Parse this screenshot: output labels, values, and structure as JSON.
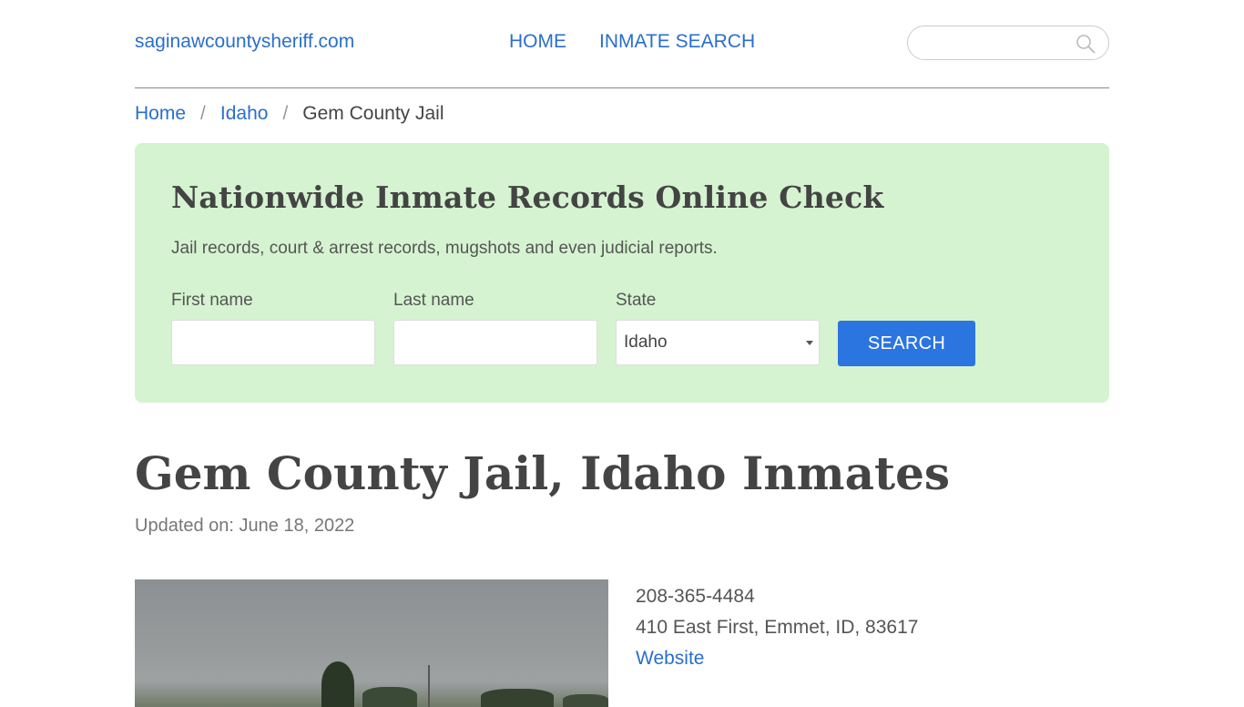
{
  "header": {
    "site_name": "saginawcountysheriff.com",
    "nav": [
      "HOME",
      "INMATE SEARCH"
    ],
    "search_placeholder": ""
  },
  "breadcrumb": {
    "items": [
      "Home",
      "Idaho"
    ],
    "current": "Gem County Jail",
    "separator": "/"
  },
  "panel": {
    "title": "Nationwide Inmate Records Online Check",
    "subtitle": "Jail records, court & arrest records, mugshots and even judicial reports.",
    "first_name_label": "First name",
    "first_name_value": "",
    "last_name_label": "Last name",
    "last_name_value": "",
    "state_label": "State",
    "state_value": "Idaho",
    "search_button": "SEARCH",
    "background_color": "#d5f3d0",
    "button_color": "#2b75e0"
  },
  "main": {
    "title": "Gem County Jail, Idaho Inmates",
    "updated": "Updated on: June 18, 2022",
    "phone": "208-365-4484",
    "address": "410 East First, Emmet, ID, 83617",
    "website_link": "Website"
  },
  "colors": {
    "link": "#2a6fcc",
    "text": "#444444"
  }
}
